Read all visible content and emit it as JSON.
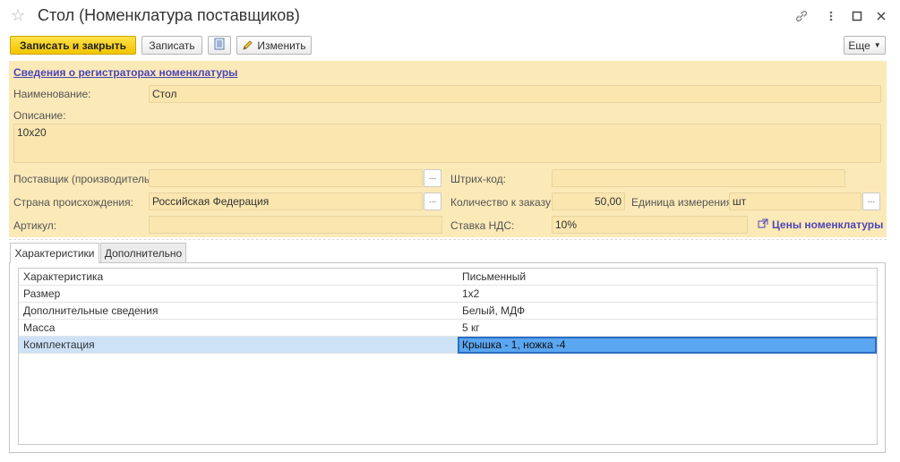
{
  "window": {
    "title": "Стол (Номенклатура поставщиков)",
    "icons": [
      "star-icon",
      "link-icon",
      "more-icon",
      "maximize-icon",
      "close-icon"
    ]
  },
  "toolbar": {
    "save_close": "Записать и закрыть",
    "save": "Записать",
    "edit": "Изменить",
    "more": "Еще"
  },
  "header": {
    "registrars_link": "Сведения о регистраторах номенклатуры",
    "name_label": "Наименование:",
    "name_value": "Стол",
    "description_label": "Описание:",
    "description_value": "10x20",
    "supplier_label": "Поставщик (производитель):",
    "supplier_value": "",
    "barcode_label": "Штрих-код:",
    "barcode_value": "",
    "country_label": "Страна происхождения:",
    "country_value": "Российская Федерация",
    "order_qty_label": "Количество к заказу:",
    "order_qty_value": "50,00",
    "unit_label": "Единица измерения:",
    "unit_value": "шт",
    "article_label": "Артикул:",
    "article_value": "",
    "vat_label": "Ставка НДС:",
    "vat_value": "10%",
    "prices_link": "Цены номенклатуры"
  },
  "tabs": [
    {
      "label": "Характеристики",
      "active": true
    },
    {
      "label": "Дополнительно",
      "active": false
    }
  ],
  "grid": {
    "rows": [
      {
        "name": "Характеристика",
        "value": "Письменный"
      },
      {
        "name": "Размер",
        "value": "1x2"
      },
      {
        "name": "Дополнительные сведения",
        "value": "Белый, МДФ"
      },
      {
        "name": "Масса",
        "value": "5 кг"
      },
      {
        "name": "Комплектация",
        "value": "Крышка - 1, ножка -4"
      }
    ]
  }
}
